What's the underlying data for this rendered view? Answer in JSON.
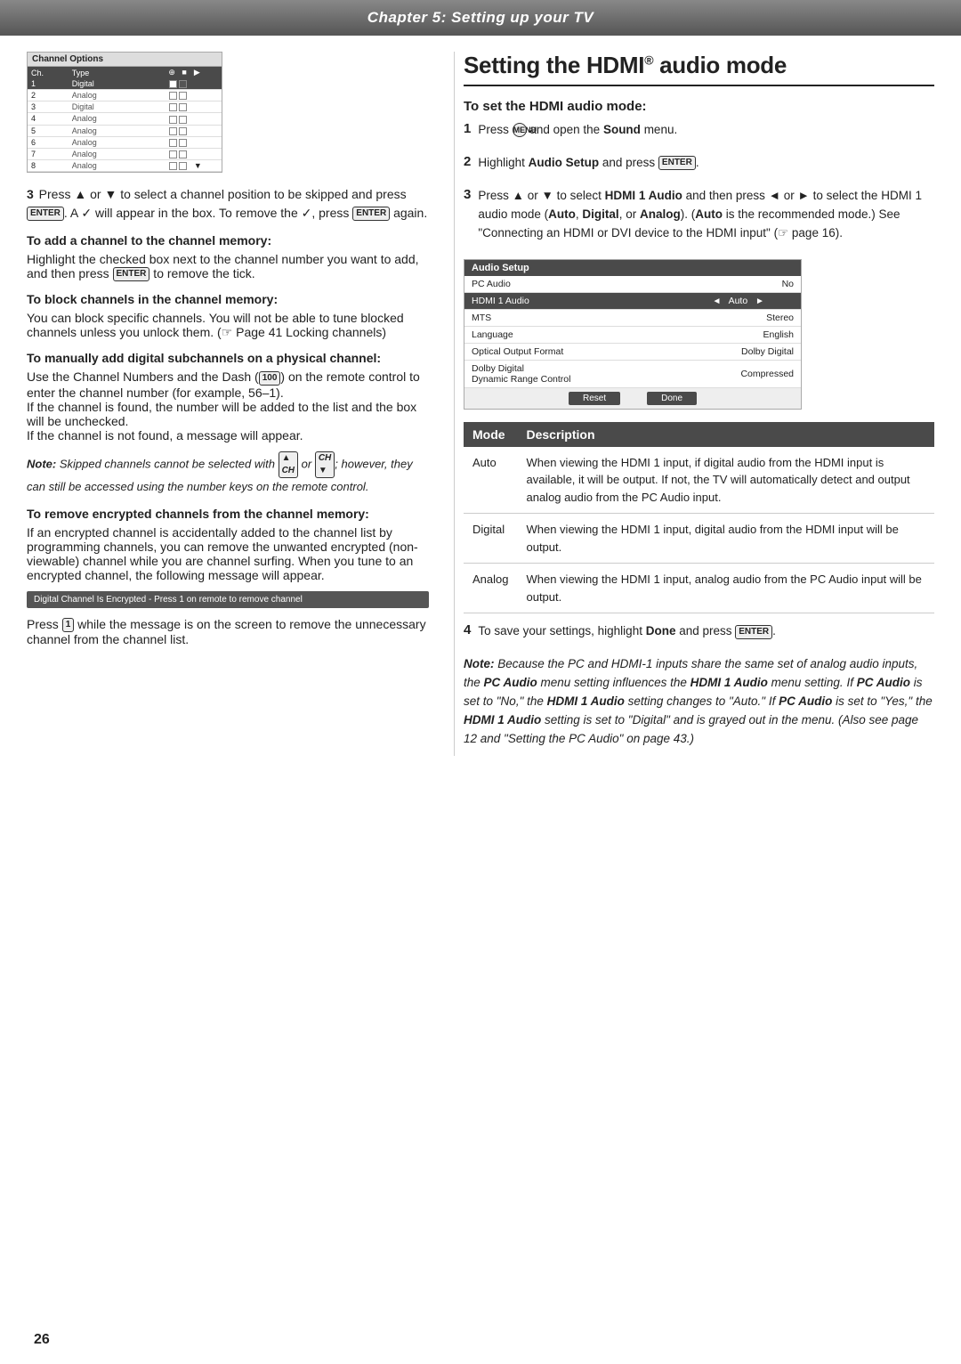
{
  "header": {
    "chapter_title": "Chapter 5: Setting up your TV"
  },
  "page_number": "26",
  "left_column": {
    "channel_options": {
      "title": "Channel Options",
      "columns": [
        "Ch.",
        "Type",
        "",
        ""
      ],
      "rows": [
        {
          "ch": "1",
          "type": "Digital",
          "selected": true
        },
        {
          "ch": "2",
          "type": "Analog",
          "selected": false
        },
        {
          "ch": "3",
          "type": "Digital",
          "selected": false
        },
        {
          "ch": "4",
          "type": "Analog",
          "selected": false
        },
        {
          "ch": "5",
          "type": "Analog",
          "selected": false
        },
        {
          "ch": "6",
          "type": "Analog",
          "selected": false
        },
        {
          "ch": "7",
          "type": "Analog",
          "selected": false
        },
        {
          "ch": "8",
          "type": "Analog",
          "selected": false
        }
      ]
    },
    "step3": "Press ▲ or ▼ to select a channel position to be skipped and press",
    "step3b": ". A ✓ will appear in the box. To remove the ✓, press",
    "step3c": "again.",
    "heading_add": "To add a channel to the channel memory:",
    "para_add": "Highlight the checked box next to the channel number you want to add, and then press  to remove the tick.",
    "heading_block": "To block channels in the channel memory:",
    "para_block": "You can block specific channels. You will not be able to tune blocked channels unless you unlock them. (☞ Page 41 Locking channels)",
    "heading_manual": "To manually add digital subchannels on a physical channel:",
    "para_manual1": "Use the Channel Numbers and the Dash ( ) on the remote control to enter the channel number (for example, 56–1).",
    "para_manual2": "If the channel is found, the number will be added to the list and the box will be unchecked.",
    "para_manual3": "If the channel is not found, a message will appear.",
    "note_italic": "Note: Skipped channels cannot be selected with  or ; however, they can still be accessed using the number keys on the remote control.",
    "heading_remove": "To remove encrypted channels from the channel memory:",
    "para_remove1": "If an encrypted channel is accidentally added to the channel list by programming channels, you can remove the unwanted encrypted (non-viewable) channel while you are channel surfing. When you tune to an encrypted channel, the following message will appear.",
    "encrypted_bar": "Digital Channel Is Encrypted - Press 1 on remote to remove channel",
    "para_remove2": "Press  1  while the message is on the screen to remove the unnecessary channel from the channel list."
  },
  "right_column": {
    "section_title": "Setting the HDMI® audio mode",
    "subsection": "To set the HDMI audio mode:",
    "step1": "Press  and open the Sound menu.",
    "step2_prefix": "Highlight ",
    "step2_bold": "Audio Setup",
    "step2_suffix": " and press ",
    "step3_prefix": "Press ▲ or ▼ to select ",
    "step3_bold": "HDMI 1 Audio",
    "step3_middle": " and then press ◄ or ► to select the HDMI 1 audio mode (",
    "step3_auto": "Auto",
    "step3_comma1": ", ",
    "step3_digital": "Digital",
    "step3_comma2": ", or ",
    "step3_analog": "Analog",
    "step3_end": "). (",
    "step3_auto2": "Auto",
    "step3_end2": " is the recommended mode.) See \"Connecting an HDMI or DVI device to the HDMI input\" (☞ page 16).",
    "audio_setup_menu": {
      "title": "Audio Setup",
      "rows": [
        {
          "label": "PC Audio",
          "value": "No",
          "selected": false
        },
        {
          "label": "HDMI 1 Audio",
          "value": "Auto",
          "selected": true,
          "has_arrows": true
        },
        {
          "label": "MTS",
          "value": "Stereo",
          "selected": false
        },
        {
          "label": "Language",
          "value": "English",
          "selected": false
        },
        {
          "label": "Optical Output Format",
          "value": "Dolby Digital",
          "selected": false
        },
        {
          "label": "Dolby Digital Dynamic Range Control",
          "value": "Compressed",
          "selected": false
        }
      ],
      "btn_reset": "Reset",
      "btn_done": "Done"
    },
    "mode_table": {
      "col_mode": "Mode",
      "col_desc": "Description",
      "rows": [
        {
          "mode": "Auto",
          "desc": "When viewing the HDMI 1 input, if digital audio from the HDMI input is available, it will be output. If not, the TV will automatically detect and output analog audio from the PC Audio input."
        },
        {
          "mode": "Digital",
          "desc": "When viewing the HDMI 1 input, digital audio from the HDMI input will be output."
        },
        {
          "mode": "Analog",
          "desc": "When viewing the HDMI 1 input, analog audio from the PC Audio input will be output."
        }
      ]
    },
    "step4": "To save your settings, highlight ",
    "step4_bold": "Done",
    "step4_suffix": " and press",
    "note_title": "Note:",
    "note_body": " Because the PC and HDMI-1 inputs share the same set of analog audio inputs, the ",
    "note_pc_audio": "PC Audio",
    "note_mid": " menu setting influences the ",
    "note_hdmi1": "HDMI 1 Audio",
    "note_mid2": " menu setting. If ",
    "note_pc2": "PC Audio",
    "note_setto_no": " is set to \"No,\" the ",
    "note_hdmi2": "HDMI 1 Audio",
    "note_auto": " setting changes to \"Auto.\" If ",
    "note_pc3": "PC Audio",
    "note_set_yes": " is set to \"Yes,\" the ",
    "note_hdmi3": "HDMI 1 Audio",
    "note_digital_end": " setting is set to \"Digital\" and is grayed out in the menu. (Also see page 12 and \"Setting the PC Audio\" on page 43.)"
  }
}
